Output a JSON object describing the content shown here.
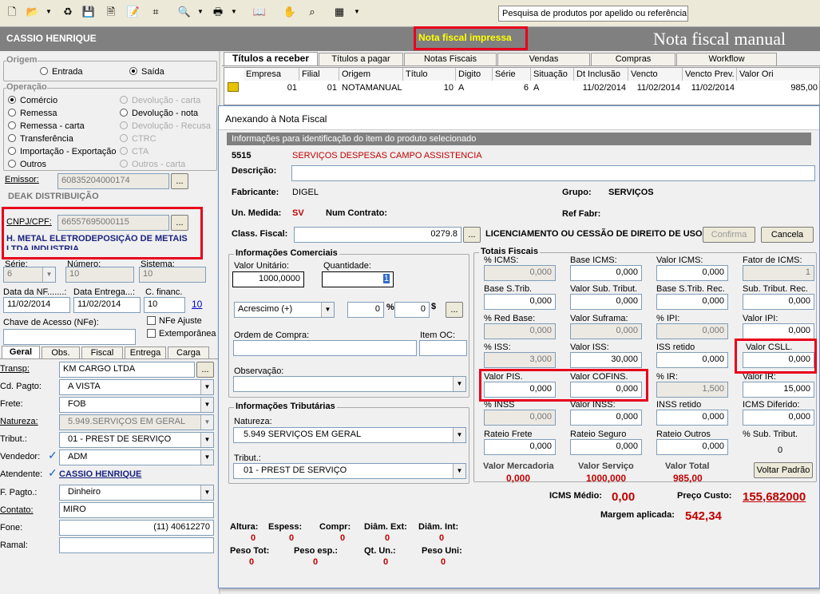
{
  "toolbar": {
    "search_hint": "Pesquisa de produtos por apelido ou referência"
  },
  "header": {
    "user": "CASSIO HENRIQUE",
    "status": "Nota fiscal impressa",
    "title": "Nota fiscal manual"
  },
  "origem": {
    "label": "Origem",
    "entrada": "Entrada",
    "saida": "Saída"
  },
  "operacao": {
    "label": "Operação",
    "items_left": [
      "Comércio",
      "Remessa",
      "Remessa - carta",
      "Transferência",
      "Importação - Exportação",
      "Outros"
    ],
    "items_right": [
      "Devolução - carta",
      "Devolução - nota",
      "Devolução - Recusa",
      "CTRC",
      "CTA",
      "Outros - carta"
    ]
  },
  "emissor": {
    "label": "Emissor:",
    "value": "60835204000174",
    "name": "DEAK DISTRIBUIÇÃO",
    "btn": "..."
  },
  "cnpj": {
    "label": "CNPJ/CPF:",
    "value": "66557695000115",
    "name": "H. METAL ELETRODEPOSIÇÃO DE METAIS LTDA INDUSTRIA"
  },
  "serie": {
    "label": "Série:",
    "value": "6"
  },
  "numero": {
    "label": "Número:",
    "value": "10"
  },
  "sistema": {
    "label": "Sistema:",
    "value": "10"
  },
  "datanf": {
    "label": "Data da NF.......:",
    "value": "11/02/2014"
  },
  "dataentrega": {
    "label": "Data Entrega...:",
    "value": "11/02/2014"
  },
  "cfinanc": {
    "label": "C. financ.",
    "value": "10",
    "link": "10"
  },
  "chave": {
    "label": "Chave de Acesso (NFe):",
    "nfe_ajuste": "NFe Ajuste",
    "extemporanea": "Extemporânea"
  },
  "lefttabs": [
    "Geral",
    "Obs.",
    "Fiscal",
    "Entrega",
    "Carga"
  ],
  "geral": {
    "transp_label": "Transp:",
    "transp": "KM CARGO LTDA",
    "cdpagto_label": "Cd. Pagto:",
    "cdpagto": "A VISTA",
    "frete_label": "Frete:",
    "frete": "FOB",
    "natureza_label": "Natureza:",
    "natureza": "5.949.SERVIÇOS EM GERAL",
    "tribut_label": "Tribut.:",
    "tribut": "01 - PREST DE SERVIÇO",
    "vendedor_label": "Vendedor:",
    "vendedor": "ADM",
    "atendente_label": "Atendente:",
    "atendente": "CASSIO HENRIQUE",
    "fpagto_label": "F. Pagto.:",
    "fpagto": "Dinheiro",
    "contato_label": "Contato:",
    "contato": "MIRO",
    "fone_label": "Fone:",
    "fone": "(11) 40612270",
    "ramal_label": "Ramal:",
    "ramal": ""
  },
  "righttabs": [
    "Títulos a receber",
    "Títulos a pagar",
    "Notas Fiscais",
    "Vendas",
    "Compras",
    "Workflow"
  ],
  "grid": {
    "headers": [
      "Empresa",
      "Filial",
      "Origem",
      "Título",
      "Digito",
      "Série",
      "Situação",
      "Dt Inclusão",
      "Vencto",
      "Vencto Prev.",
      "Valor Ori"
    ],
    "row": [
      "01",
      "01",
      "NOTAMANUAL",
      "10",
      "A",
      "6",
      "A",
      "11/02/2014",
      "11/02/2014",
      "11/02/2014",
      "985,00"
    ]
  },
  "dialog": {
    "title": "Anexando à Nota Fiscal",
    "subtitle": "Informações para identificação do item do produto selecionado",
    "code": "5515",
    "product": "SERVIÇOS DESPESAS CAMPO ASSISTENCIA",
    "descricao_label": "Descrição:",
    "descricao": "",
    "fabricante_label": "Fabricante:",
    "fabricante": "DIGEL",
    "grupo_label": "Grupo:",
    "grupo": "SERVIÇOS",
    "unmedida_label": "Un. Medida:",
    "unmedida": "SV",
    "numcontrato_label": "Num Contrato:",
    "reffabr_label": "Ref Fabr:",
    "classfiscal_label": "Class. Fiscal:",
    "classfiscal": "0279.8",
    "classfiscal_desc": "LICENCIAMENTO OU CESSÃO DE DIREITO DE USO",
    "confirma": "Confirma",
    "cancela": "Cancela",
    "comerciais": {
      "label": "Informações Comerciais",
      "valor_unit_label": "Valor Unitário:",
      "valor_unit": "1000,0000",
      "qtd_label": "Quantidade:",
      "qtd": "1",
      "acrescimo": "Acrescimo  (+)",
      "pct": "0",
      "pct_sym": "%",
      "val": "0",
      "val_sym": "$",
      "ordem_label": "Ordem de Compra:",
      "itemoc_label": "Item OC:",
      "obs_label": "Observação:"
    },
    "tributarias": {
      "label": "Informações Tributárias",
      "natureza_label": "Natureza:",
      "natureza": "5.949 SERVIÇOS EM GERAL",
      "tribut_label": "Tribut.:",
      "tribut": "01 - PREST DE SERVIÇO"
    },
    "totais": {
      "label": "Totais Fiscais",
      "fields": [
        {
          "label": "% ICMS:",
          "value": "0,000",
          "ro": true
        },
        {
          "label": "Base ICMS:",
          "value": "0,000",
          "ro": false
        },
        {
          "label": "Valor ICMS:",
          "value": "0,000",
          "ro": false
        },
        {
          "label": "Fator de ICMS:",
          "value": "1",
          "ro": true
        },
        {
          "label": "Base S.Trib.",
          "value": "0,000",
          "ro": false
        },
        {
          "label": "Valor Sub. Tribut.",
          "value": "0,000",
          "ro": false
        },
        {
          "label": "Base S.Trib. Rec.",
          "value": "0,000",
          "ro": false
        },
        {
          "label": "Sub. Tribut. Rec.",
          "value": "0,000",
          "ro": false
        },
        {
          "label": "% Red Base:",
          "value": "0,000",
          "ro": true
        },
        {
          "label": "Valor Suframa:",
          "value": "0,000",
          "ro": true
        },
        {
          "label": "% IPI:",
          "value": "0,000",
          "ro": true
        },
        {
          "label": "Valor IPI:",
          "value": "0,000",
          "ro": false
        },
        {
          "label": "% ISS:",
          "value": "3,000",
          "ro": true
        },
        {
          "label": "Valor ISS:",
          "value": "30,000",
          "ro": false
        },
        {
          "label": "ISS retido",
          "value": "0,000",
          "ro": false
        },
        {
          "label": "Valor CSLL.",
          "value": "0,000",
          "ro": false
        },
        {
          "label": "Valor PIS.",
          "value": "0,000",
          "ro": false
        },
        {
          "label": "Valor COFINS.",
          "value": "0,000",
          "ro": false
        },
        {
          "label": "% IR:",
          "value": "1,500",
          "ro": true
        },
        {
          "label": "Valor IR:",
          "value": "15,000",
          "ro": false
        },
        {
          "label": "% INSS",
          "value": "0,000",
          "ro": true
        },
        {
          "label": "Valor INSS:",
          "value": "0,000",
          "ro": false
        },
        {
          "label": "INSS retido",
          "value": "0,000",
          "ro": false
        },
        {
          "label": "ICMS Diferido:",
          "value": "0,000",
          "ro": false
        },
        {
          "label": "Rateio Frete",
          "value": "0,000",
          "ro": false
        },
        {
          "label": "Rateio Seguro",
          "value": "0,000",
          "ro": false
        },
        {
          "label": "Rateio Outros",
          "value": "0,000",
          "ro": false
        },
        {
          "label": "% Sub. Tribut.",
          "value": "0",
          "ro": false
        }
      ],
      "vmerc_label": "Valor Mercadoria",
      "vmerc": "0,000",
      "vserv_label": "Valor Serviço",
      "vserv": "1000,000",
      "vtotal_label": "Valor Total",
      "vtotal": "985,00",
      "voltar": "Voltar Padrão"
    },
    "icms_medio_label": "ICMS Médio:",
    "icms_medio": "0,00",
    "preco_custo_label": "Preço Custo:",
    "preco_custo": "155,682000",
    "margem_label": "Margem aplicada:",
    "margem": "542,34",
    "dims1": [
      {
        "label": "Altura:",
        "value": "0"
      },
      {
        "label": "Espess:",
        "value": "0"
      },
      {
        "label": "Compr:",
        "value": "0"
      },
      {
        "label": "Diâm. Ext:",
        "value": "0"
      },
      {
        "label": "Diâm. Int:",
        "value": "0"
      }
    ],
    "dims2": [
      {
        "label": "Peso Tot:",
        "value": "0"
      },
      {
        "label": "Peso esp.:",
        "value": "0"
      },
      {
        "label": "Qt. Un.:",
        "value": "0"
      },
      {
        "label": "Peso Uni:",
        "value": "0"
      }
    ]
  }
}
